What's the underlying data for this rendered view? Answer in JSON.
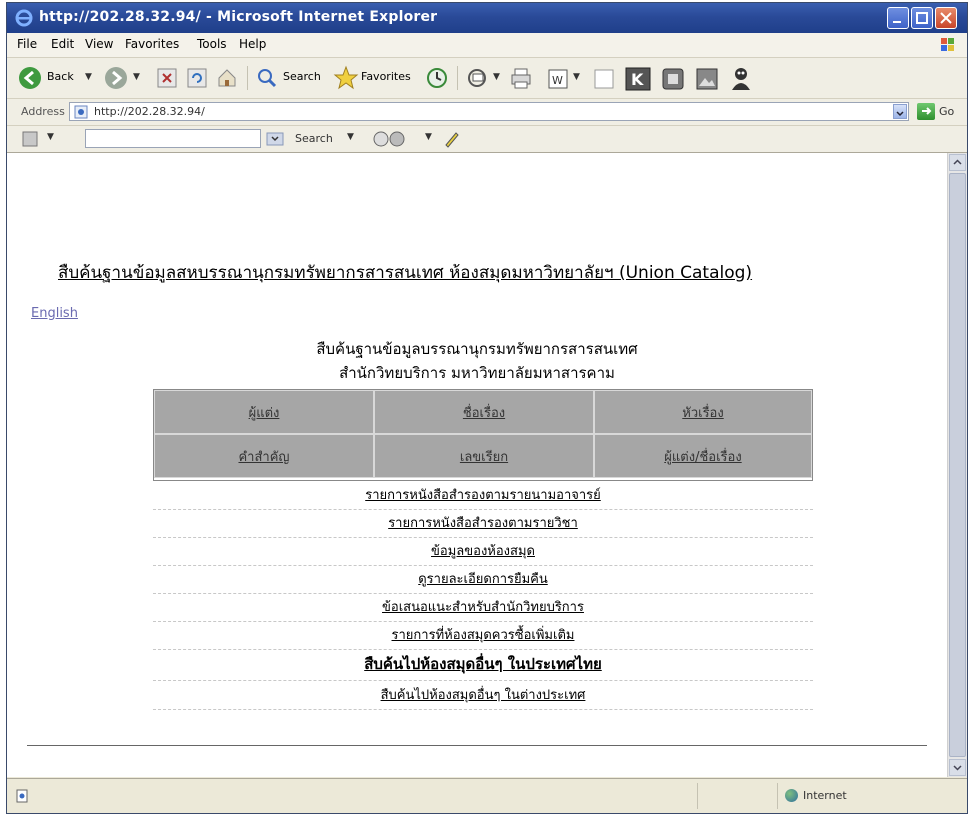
{
  "window": {
    "title": "http://202.28.32.94/ - Microsoft Internet Explorer"
  },
  "menu": [
    "File",
    "Edit",
    "View",
    "Favorites",
    "Tools",
    "Help"
  ],
  "toolbar": {
    "back_label": "Back",
    "search_label": "Search",
    "favorites_label": "Favorites"
  },
  "address": {
    "label": "Address",
    "url": "http://202.28.32.94/",
    "go_label": "Go"
  },
  "searchbar": {
    "search_label": "Search"
  },
  "page": {
    "heading_link": "สืบค้นฐานข้อมูลสหบรรณานุกรมทรัพยากรสารสนเทศ ห้องสมุดมหาวิทยาลัยฯ (Union Catalog)",
    "english_link": "English",
    "subtitle_1": "สืบค้นฐานข้อมูลบรรณานุกรมทรัพยากรสารสนเทศ",
    "subtitle_2": "สำนักวิทยบริการ มหาวิทยาลัยมหาสารคาม",
    "search_grid": [
      [
        "ผู้แต่ง",
        "ชื่อเรื่อง",
        "หัวเรื่อง"
      ],
      [
        "คำสำคัญ",
        "เลขเรียก",
        "ผู้แต่ง/ชื่อเรื่อง"
      ]
    ],
    "links": [
      "รายการหนังสือสำรองตามรายนามอาจารย์",
      "รายการหนังสือสำรองตามรายวิชา",
      "ข้อมูลของห้องสมุด",
      "ดูรายละเอียดการยืมคืน",
      "ข้อเสนอแนะสำหรับสำนักวิทยบริการ",
      "รายการที่ห้องสมุดควรซื้อเพิ่มเติม",
      "สืบค้นไปห้องสมุดอื่นๆ ในประเทศไทย",
      "สืบค้นไปห้องสมุดอื่นๆ ในต่างประเทศ"
    ]
  },
  "status": {
    "zone": "Internet"
  },
  "colors": {
    "title_bar": "#2a4a98",
    "grid_cell": "#a6a6a6",
    "link_english": "#6a6ab0"
  }
}
